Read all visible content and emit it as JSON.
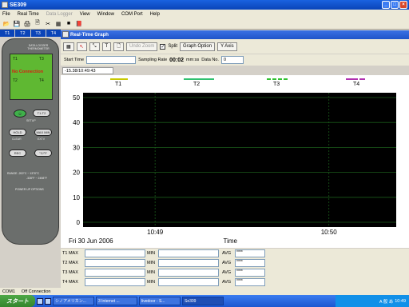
{
  "window": {
    "title": "SE309"
  },
  "menu": [
    "File",
    "Real Time",
    "Data Logger",
    "View",
    "Window",
    "COM Port",
    "Help"
  ],
  "menu_disabled": [
    false,
    false,
    true,
    false,
    false,
    false,
    false
  ],
  "channel_tabs": [
    "T1",
    "T2",
    "T3",
    "T4"
  ],
  "meter": {
    "brand": "DATA LOGGER THERMOMETER",
    "lcd_t1": "T1",
    "lcd_t3": "T3",
    "lcd_t2": "T2",
    "lcd_t4": "T4",
    "lcd_status": "No Connection",
    "setup": "SETUP",
    "buttons": [
      "T1-T2",
      "HOLD",
      "MAX MIN",
      "REC",
      "°C/°F"
    ],
    "labels": [
      "CLEAR",
      "EXTV"
    ],
    "range1": "RANGE  -200°C ~ 1370°C",
    "range2": "-328°F ~ 2498°F",
    "option": "POWER UP OPTIONS"
  },
  "graph_window": {
    "title": "Real-Time Graph"
  },
  "graph_toolbar": {
    "undo_zoom": "Undo Zoom",
    "split_label": "Split",
    "split_checked": true,
    "graph_option": "Graph Option",
    "y_axis": "Y Axis"
  },
  "info": {
    "start_time_label": "Start Time",
    "start_time_value": "",
    "sampling_rate_label": "Sampling Rate",
    "sampling_rate_value": "00:02",
    "sampling_units": "mm:ss",
    "data_no_label": "Data No.",
    "data_no_value": "0"
  },
  "timestamp": "-15.38/10:49:43",
  "legend": [
    "T1",
    "T2",
    "T3",
    "T4"
  ],
  "stats": {
    "rows": [
      {
        "max_label": "T1 MAX",
        "min_label": "MIN",
        "avg_label": "AVG",
        "max": "",
        "min": "",
        "avg": "****"
      },
      {
        "max_label": "T2 MAX",
        "min_label": "MIN",
        "avg_label": "AVG",
        "max": "",
        "min": "",
        "avg": "****"
      },
      {
        "max_label": "T3 MAX",
        "min_label": "MIN",
        "avg_label": "AVG",
        "max": "",
        "min": "",
        "avg": "****"
      },
      {
        "max_label": "T4 MAX",
        "min_label": "MIN",
        "avg_label": "AVG",
        "max": "",
        "min": "",
        "avg": "****"
      }
    ]
  },
  "status_bar": [
    "COM1",
    "Off Connection"
  ],
  "taskbar": {
    "start": "スタート",
    "tasks": [
      "シノアメリカン...",
      "3 Internet ...",
      "livedoor - S...",
      "Se309"
    ],
    "tray_text": "A 般 あ",
    "clock": "10:49"
  },
  "chart_data": {
    "type": "line",
    "series": [
      {
        "name": "T1",
        "color": "#c8c800",
        "values": []
      },
      {
        "name": "T2",
        "color": "#30c070",
        "values": []
      },
      {
        "name": "T3",
        "color": "#30c030",
        "values": []
      },
      {
        "name": "T4",
        "color": "#b030b0",
        "values": []
      }
    ],
    "yticks": [
      50,
      40,
      30,
      20,
      10,
      0
    ],
    "ylim": [
      0,
      50
    ],
    "xtick_labels": [
      "10:49",
      "10:50"
    ],
    "date_label": "Fri 30 Jun 2006",
    "xlabel": "Time",
    "background": "#000000",
    "grid": true
  },
  "colors": {
    "title": "#0a44b8",
    "chart_bg": "#000000",
    "grid": "#1a5a1a",
    "lcd": "#5fb832"
  }
}
